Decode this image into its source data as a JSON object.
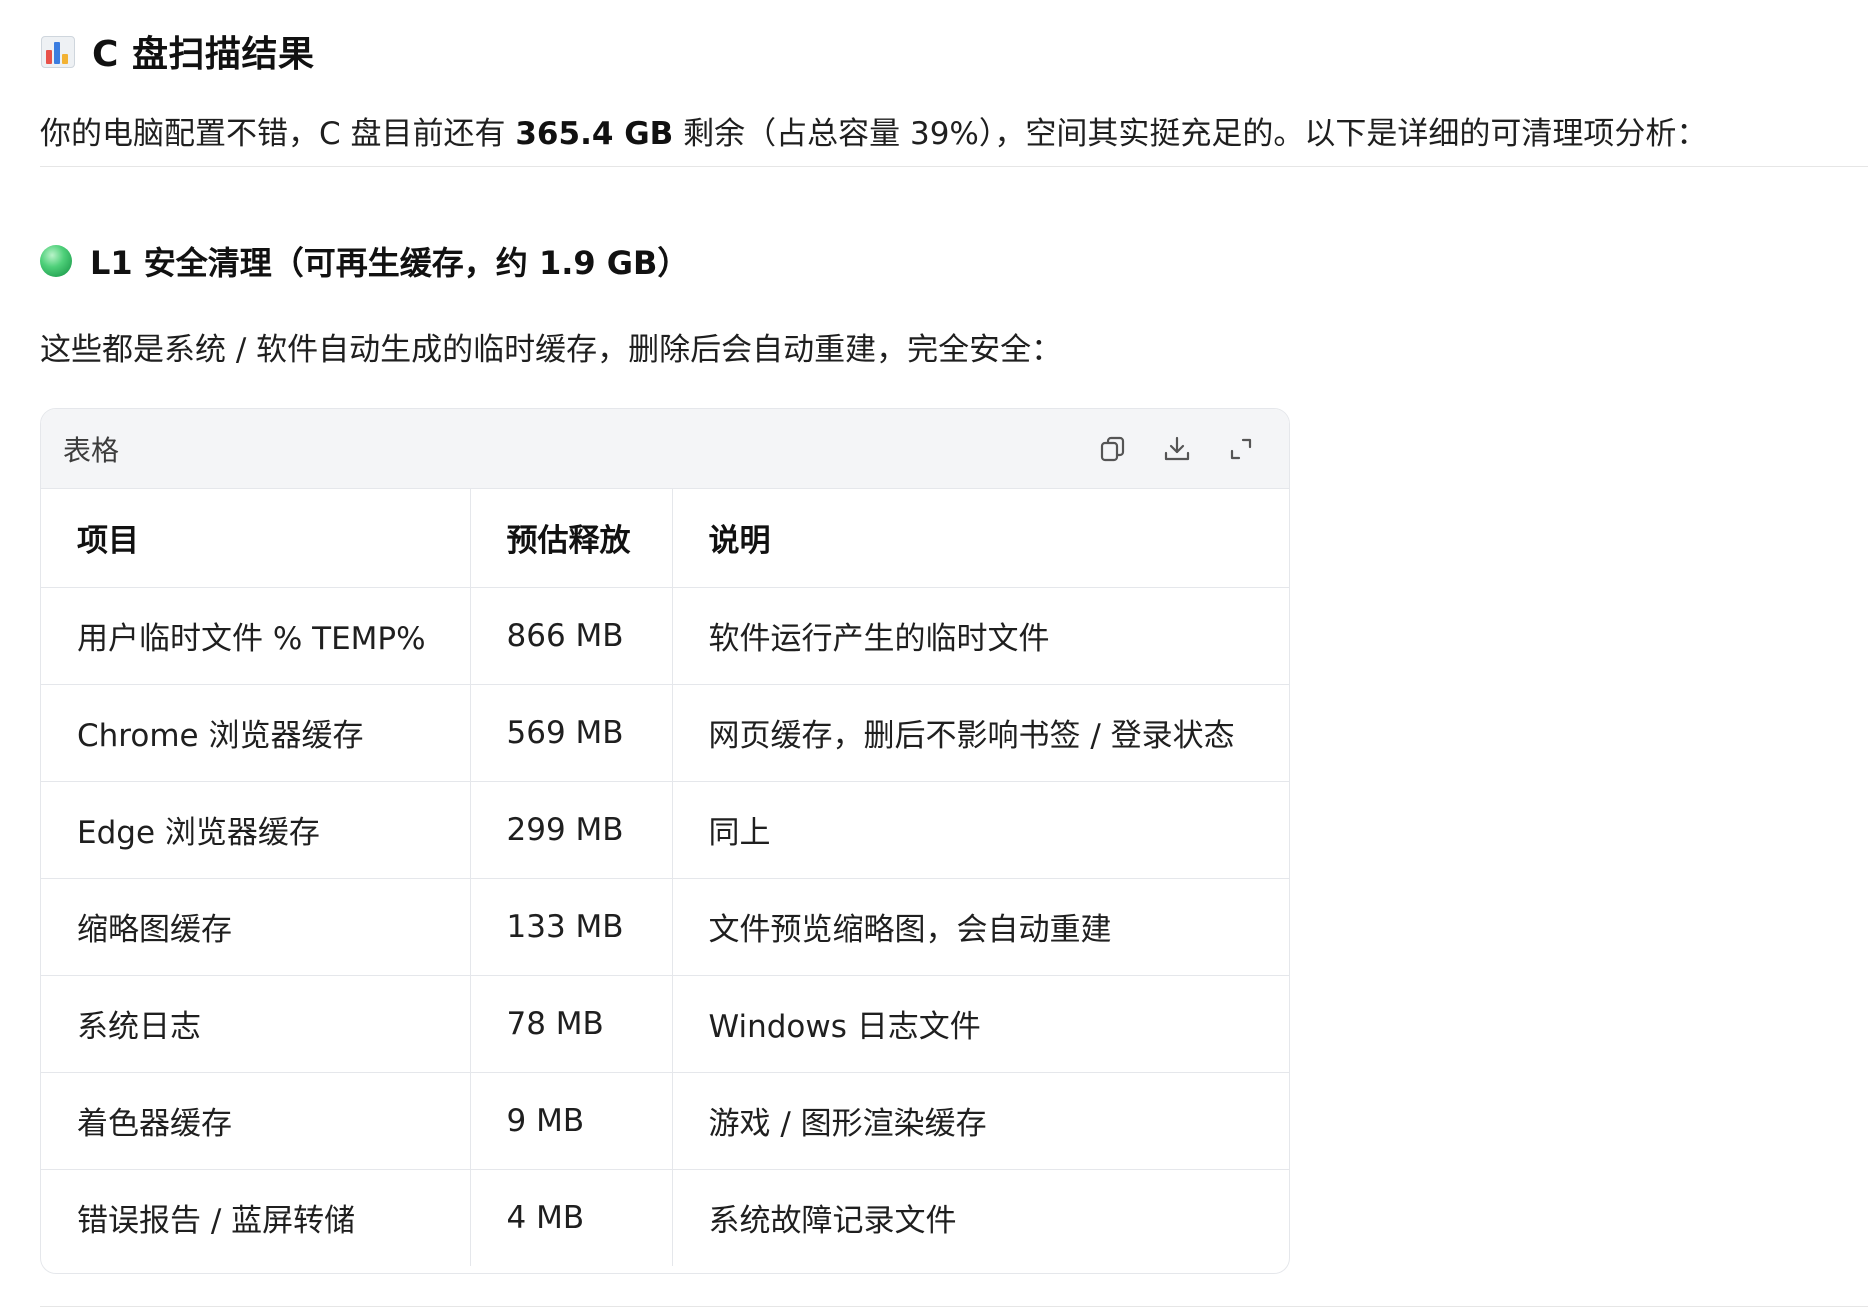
{
  "heading": {
    "icon": "bar-chart-icon",
    "title": "C 盘扫描结果"
  },
  "intro": {
    "before": "你的电脑配置不错，C 盘目前还有 ",
    "highlight": "365.4 GB",
    "after": " 剩余（占总容量 39%），空间其实挺充足的。以下是详细的可清理项分析："
  },
  "section": {
    "icon": "green-circle-icon",
    "title": "L1 安全清理（可再生缓存，约 1.9 GB）",
    "description": "这些都是系统 / 软件自动生成的临时缓存，删除后会自动重建，完全安全："
  },
  "table": {
    "label": "表格",
    "tools": [
      "copy-icon",
      "download-icon",
      "expand-icon"
    ],
    "columns": [
      "项目",
      "预估释放",
      "说明"
    ],
    "rows": [
      [
        "用户临时文件 % TEMP%",
        "866 MB",
        "软件运行产生的临时文件"
      ],
      [
        "Chrome 浏览器缓存",
        "569 MB",
        "网页缓存，删后不影响书签 / 登录状态"
      ],
      [
        "Edge 浏览器缓存",
        "299 MB",
        "同上"
      ],
      [
        "缩略图缓存",
        "133 MB",
        "文件预览缩略图，会自动重建"
      ],
      [
        "系统日志",
        "78 MB",
        "Windows 日志文件"
      ],
      [
        "着色器缓存",
        "9 MB",
        "游戏 / 图形渲染缓存"
      ],
      [
        "错误报告 / 蓝屏转储",
        "4 MB",
        "系统故障记录文件"
      ]
    ]
  }
}
